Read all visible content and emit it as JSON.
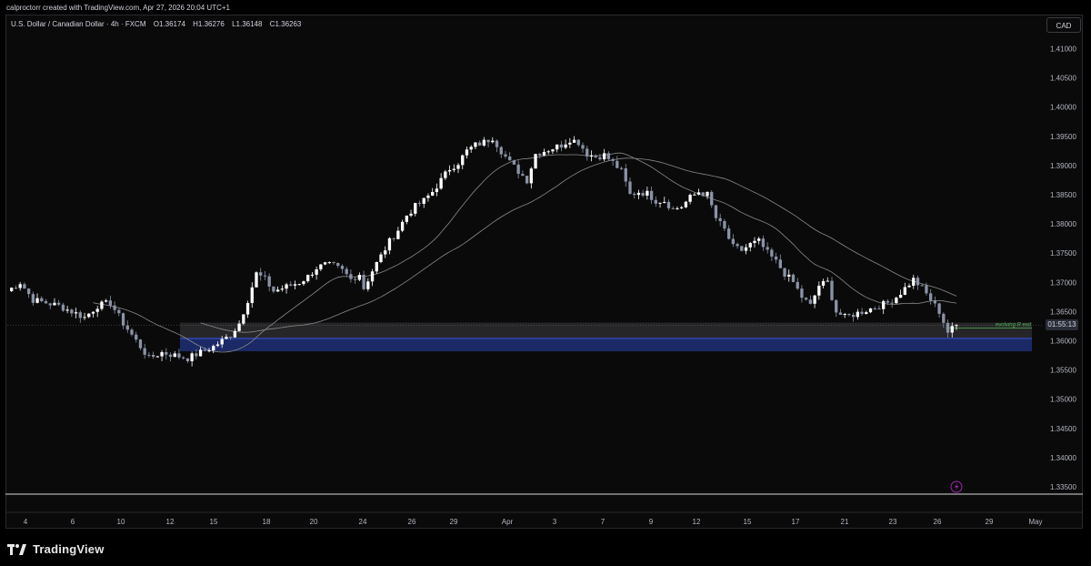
{
  "header": {
    "credit": "calproctorr created with TradingView.com, Apr 27, 2026 20:04 UTC+1"
  },
  "legend": {
    "symbol": "U.S. Dollar / Canadian Dollar · 4h · FXCM",
    "open_label": "O",
    "open": "1.36174",
    "high_label": "H",
    "high": "1.36276",
    "low_label": "L",
    "low": "1.36148",
    "close_label": "C",
    "close": "1.36263"
  },
  "currency": "CAD",
  "countdown": "01:55:13",
  "annotation": "evolving R exit",
  "brand": "TradingView",
  "colors": {
    "background": "#0a0a0b",
    "up_candle": "#ffffff",
    "down_candle": "#8a93a6",
    "zone_blue": "#1b2a66",
    "zone_grey": "#2b2b2e",
    "ma": "#8a8a8a",
    "annotation": "#4caf50",
    "alert": "#9c27b0"
  },
  "chart_data": {
    "type": "candlestick",
    "ylim": [
      1.3325,
      1.4125
    ],
    "y_ticks": [
      "1.41000",
      "1.40500",
      "1.40000",
      "1.39500",
      "1.39000",
      "1.38500",
      "1.38000",
      "1.37500",
      "1.37000",
      "1.36500",
      "1.36000",
      "1.35500",
      "1.35000",
      "1.34500",
      "1.34000",
      "1.33500"
    ],
    "x_ticks": [
      "4",
      "6",
      "10",
      "12",
      "15",
      "18",
      "20",
      "24",
      "26",
      "29",
      "Apr",
      "3",
      "7",
      "9",
      "12",
      "15",
      "17",
      "21",
      "23",
      "26",
      "29",
      "May"
    ],
    "close_path": [
      [
        0,
        1.3685
      ],
      [
        3,
        1.37
      ],
      [
        6,
        1.367
      ],
      [
        9,
        1.3665
      ],
      [
        12,
        1.366
      ],
      [
        15,
        1.365
      ],
      [
        18,
        1.364
      ],
      [
        21,
        1.366
      ],
      [
        24,
        1.3665
      ],
      [
        27,
        1.363
      ],
      [
        30,
        1.36
      ],
      [
        33,
        1.357
      ],
      [
        36,
        1.358
      ],
      [
        39,
        1.3575
      ],
      [
        42,
        1.357
      ],
      [
        45,
        1.358
      ],
      [
        48,
        1.359
      ],
      [
        50,
        1.36
      ],
      [
        52,
        1.361
      ],
      [
        54,
        1.363
      ],
      [
        56,
        1.367
      ],
      [
        58,
        1.3715
      ],
      [
        60,
        1.3705
      ],
      [
        62,
        1.3685
      ],
      [
        64,
        1.369
      ],
      [
        66,
        1.3695
      ],
      [
        68,
        1.37
      ],
      [
        70,
        1.371
      ],
      [
        72,
        1.3725
      ],
      [
        74,
        1.373
      ],
      [
        76,
        1.3728
      ],
      [
        78,
        1.372
      ],
      [
        80,
        1.3705
      ],
      [
        82,
        1.3715
      ],
      [
        83,
        1.369
      ],
      [
        85,
        1.372
      ],
      [
        87,
        1.3745
      ],
      [
        89,
        1.377
      ],
      [
        91,
        1.379
      ],
      [
        93,
        1.3815
      ],
      [
        95,
        1.383
      ],
      [
        97,
        1.384
      ],
      [
        99,
        1.3855
      ],
      [
        101,
        1.3875
      ],
      [
        103,
        1.3895
      ],
      [
        105,
        1.3905
      ],
      [
        107,
        1.3925
      ],
      [
        109,
        1.3935
      ],
      [
        111,
        1.394
      ],
      [
        113,
        1.3948
      ],
      [
        115,
        1.3925
      ],
      [
        117,
        1.3905
      ],
      [
        119,
        1.389
      ],
      [
        121,
        1.3875
      ],
      [
        123,
        1.392
      ],
      [
        125,
        1.3925
      ],
      [
        127,
        1.393
      ],
      [
        129,
        1.3935
      ],
      [
        131,
        1.3945
      ],
      [
        133,
        1.394
      ],
      [
        135,
        1.392
      ],
      [
        137,
        1.3915
      ],
      [
        139,
        1.3918
      ],
      [
        141,
        1.3905
      ],
      [
        143,
        1.389
      ],
      [
        145,
        1.385
      ],
      [
        147,
        1.3855
      ],
      [
        149,
        1.3852
      ],
      [
        151,
        1.384
      ],
      [
        153,
        1.384
      ],
      [
        155,
        1.3825
      ],
      [
        157,
        1.383
      ],
      [
        159,
        1.3845
      ],
      [
        161,
        1.3855
      ],
      [
        163,
        1.385
      ],
      [
        165,
        1.381
      ],
      [
        167,
        1.379
      ],
      [
        169,
        1.376
      ],
      [
        171,
        1.3755
      ],
      [
        173,
        1.3765
      ],
      [
        175,
        1.377
      ],
      [
        177,
        1.375
      ],
      [
        179,
        1.3735
      ],
      [
        181,
        1.3715
      ],
      [
        183,
        1.37
      ],
      [
        185,
        1.3675
      ],
      [
        187,
        1.366
      ],
      [
        189,
        1.3695
      ],
      [
        191,
        1.37
      ],
      [
        193,
        1.365
      ],
      [
        195,
        1.364
      ],
      [
        197,
        1.3645
      ],
      [
        199,
        1.365
      ],
      [
        201,
        1.3655
      ],
      [
        203,
        1.366
      ],
      [
        205,
        1.3665
      ],
      [
        207,
        1.3675
      ],
      [
        209,
        1.369
      ],
      [
        211,
        1.3705
      ],
      [
        213,
        1.369
      ],
      [
        215,
        1.367
      ],
      [
        217,
        1.365
      ],
      [
        219,
        1.3615
      ],
      [
        221,
        1.3626
      ]
    ]
  }
}
